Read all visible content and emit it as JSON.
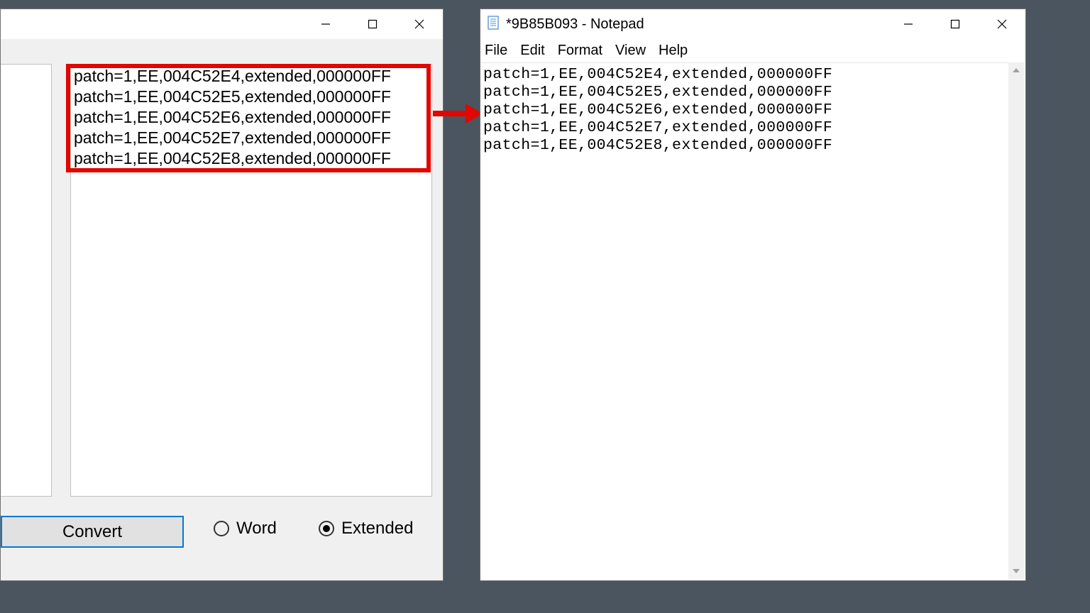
{
  "left_window": {
    "output_lines": [
      "patch=1,EE,004C52E4,extended,000000FF",
      "patch=1,EE,004C52E5,extended,000000FF",
      "patch=1,EE,004C52E6,extended,000000FF",
      "patch=1,EE,004C52E7,extended,000000FF",
      "patch=1,EE,004C52E8,extended,000000FF"
    ],
    "buttons": {
      "convert": "Convert"
    },
    "radios": {
      "word": "Word",
      "extended": "Extended",
      "selected": "extended"
    }
  },
  "notepad": {
    "title": "*9B85B093 - Notepad",
    "menu": {
      "file": "File",
      "edit": "Edit",
      "format": "Format",
      "view": "View",
      "help": "Help"
    },
    "content_lines": [
      "patch=1,EE,004C52E4,extended,000000FF",
      "patch=1,EE,004C52E5,extended,000000FF",
      "patch=1,EE,004C52E6,extended,000000FF",
      "patch=1,EE,004C52E7,extended,000000FF",
      "patch=1,EE,004C52E8,extended,000000FF"
    ]
  },
  "annotation": {
    "arrow_color": "#e10600",
    "highlight_color": "#e10600"
  }
}
